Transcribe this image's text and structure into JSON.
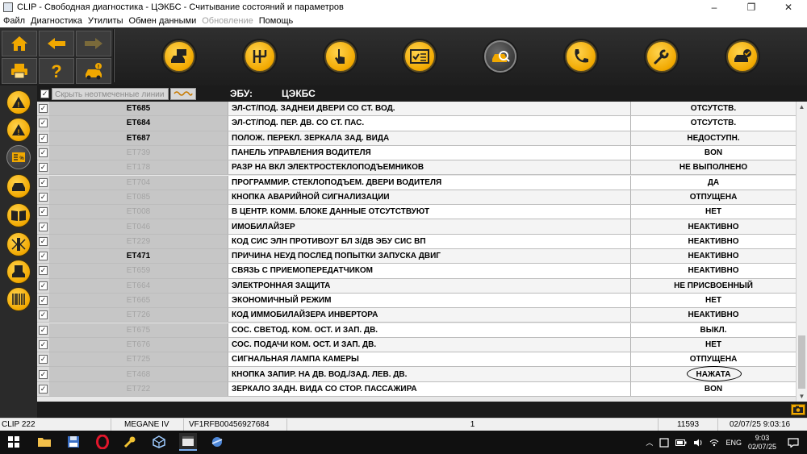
{
  "window": {
    "title": "CLIP - Свободная диагностика - ЦЭКБС - Считывание состояний и параметров",
    "minimize": "–",
    "maximize": "❐",
    "close": "✕"
  },
  "menu": [
    {
      "label": "Файл",
      "enabled": true
    },
    {
      "label": "Диагностика",
      "enabled": true
    },
    {
      "label": "Утилиты",
      "enabled": true
    },
    {
      "label": "Обмен данными",
      "enabled": true
    },
    {
      "label": "Обновление",
      "enabled": false
    },
    {
      "label": "Помощь",
      "enabled": true
    }
  ],
  "toolbar": {
    "nav_icons": [
      "home-icon",
      "back-arrow-icon",
      "forward-arrow-icon",
      "print-icon",
      "help-icon",
      "vehicle-info-icon"
    ],
    "round_icons": [
      "vehicle-id-icon",
      "gearbox-icon",
      "touch-test-icon",
      "checklist-icon",
      "ecu-scan-icon",
      "phone-support-icon",
      "repair-wrench-icon",
      "vehicle-check-icon"
    ],
    "active_round": "ecu-scan-icon"
  },
  "sidebar": {
    "icons": [
      "warning-icon",
      "warning-alt-icon",
      "parameters-icon",
      "car-config-icon",
      "manual-book-icon",
      "network-icon",
      "vehicle-save-icon",
      "barcode-icon"
    ],
    "active": "parameters-icon"
  },
  "header": {
    "hide_unchecked_label": "Скрыть неотмеченные линии",
    "ecu_label": "ЭБУ:",
    "ecu_name": "ЦЭКБС"
  },
  "table": {
    "rows": [
      {
        "code": "ET685",
        "name": "ЭЛ-СТ/ПОД. ЗАДНЕИ ДВЕРИ СО СТ. ВОД.",
        "value": "ОТСУТСТВ.",
        "active": true
      },
      {
        "code": "ET684",
        "name": "ЭЛ-СТ/ПОД. ПЕР. ДВ. СО СТ. ПАС.",
        "value": "ОТСУТСТВ.",
        "active": true
      },
      {
        "code": "ET687",
        "name": "ПОЛОЖ. ПЕРЕКЛ. ЗЕРКАЛА ЗАД. ВИДА",
        "value": "НЕДОСТУПН.",
        "active": true
      },
      {
        "code": "ET739",
        "name": "ПАНЕЛЬ УПРАВЛЕНИЯ ВОДИТЕЛЯ",
        "value": "BON",
        "active": false
      },
      {
        "code": "ET178",
        "name": "РАЗР НА ВКЛ ЭЛЕКТРОСТЕКЛОПОДЪЕМНИКОВ",
        "value": "НЕ ВЫПОЛНЕНО",
        "active": false
      },
      {
        "code": "ET704",
        "name": "ПРОГРАММИР. СТЕКЛОПОДЪЕМ. ДВЕРИ ВОДИТЕЛЯ",
        "value": "ДА",
        "active": false
      },
      {
        "code": "ET085",
        "name": "КНОПКА АВАРИЙНОЙ СИГНАЛИЗАЦИИ",
        "value": "ОТПУЩЕНА",
        "active": false
      },
      {
        "code": "ET008",
        "name": "В ЦЕНТР. КОММ. БЛОКЕ ДАННЫЕ ОТСУТСТВУЮТ",
        "value": "НЕТ",
        "active": false
      },
      {
        "code": "ET046",
        "name": "ИМОБИЛАЙЗЕР",
        "value": "НЕАКТИВНО",
        "active": false
      },
      {
        "code": "ET229",
        "name": "КОД СИС ЭЛН ПРОТИВОУГ БЛ З/ДВ ЭБУ СИС ВП",
        "value": "НЕАКТИВНО",
        "active": false
      },
      {
        "code": "ET471",
        "name": "ПРИЧИНА НЕУД ПОСЛЕД ПОПЫТКИ ЗАПУСКА ДВИГ",
        "value": "НЕАКТИВНО",
        "active": true
      },
      {
        "code": "ET659",
        "name": "СВЯЗЬ С ПРИЕМОПЕРЕДАТЧИКОМ",
        "value": "НЕАКТИВНО",
        "active": false
      },
      {
        "code": "ET664",
        "name": "ЭЛЕКТРОННАЯ ЗАЩИТА",
        "value": "НЕ ПРИСВОЕННЫЙ",
        "active": false
      },
      {
        "code": "ET665",
        "name": "ЭКОНОМИЧНЫЙ РЕЖИМ",
        "value": "НЕТ",
        "active": false
      },
      {
        "code": "ET726",
        "name": "КОД ИММОБИЛАЙЗЕРА ИНВЕРТОРА",
        "value": "НЕАКТИВНО",
        "active": false
      },
      {
        "code": "ET675",
        "name": "СОС. СВЕТОД. КОМ. ОСТ. И ЗАП. ДВ.",
        "value": "ВЫКЛ.",
        "active": false
      },
      {
        "code": "ET676",
        "name": "СОС. ПОДАЧИ КОМ. ОСТ. И ЗАП. ДВ.",
        "value": "НЕТ",
        "active": false
      },
      {
        "code": "ET725",
        "name": "СИГНАЛЬНАЯ ЛАМПА КАМЕРЫ",
        "value": "ОТПУЩЕНА",
        "active": false
      },
      {
        "code": "ET468",
        "name": "КНОПКА ЗАПИР. НА ДВ. ВОД./ЗАД. ЛЕВ. ДВ.",
        "value": "НАЖАТА",
        "active": false,
        "circled": true
      },
      {
        "code": "ET722",
        "name": "ЗЕРКАЛО ЗАДН. ВИДА СО СТОР. ПАССАЖИРА",
        "value": "BON",
        "active": false
      }
    ]
  },
  "status": {
    "device": "CLIP 222",
    "model": "MEGANE IV",
    "vin": "VF1RFB00456927684",
    "page": "1",
    "count": "11593",
    "datetime": "02/07/25 9:03:16"
  },
  "taskbar": {
    "apps": [
      "start-icon",
      "file-explorer-icon",
      "save-disk-icon",
      "opera-icon",
      "tool-icon",
      "3d-box-icon",
      "clip-app-icon",
      "satellite-icon"
    ],
    "lang": "ENG",
    "time": "9:03",
    "date": "02/07/25"
  },
  "colors": {
    "accent": "#f1a800",
    "dark_bg": "#1b1b1b",
    "inactive_code": "#a4a4a4"
  }
}
